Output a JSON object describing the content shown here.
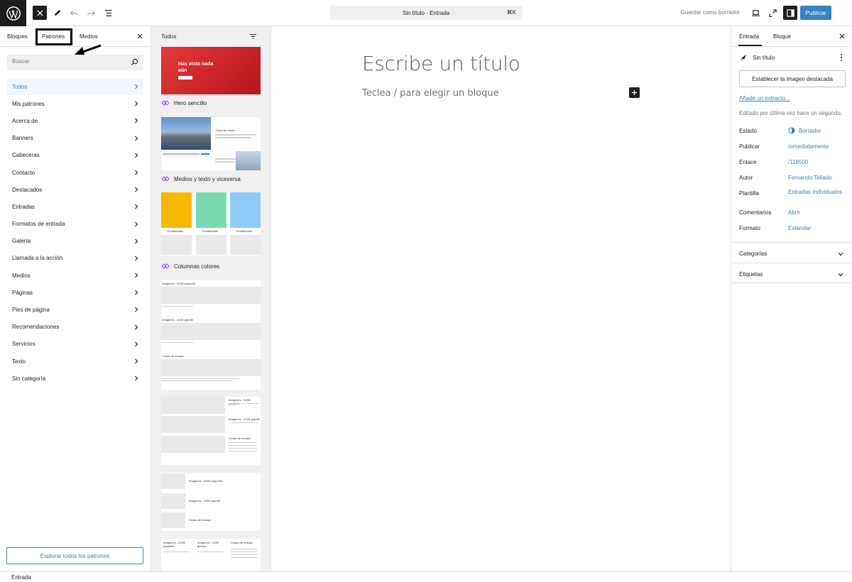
{
  "topbar": {
    "command_title": "Sin título · Entrada",
    "command_shortcut": "⌘K",
    "save_draft": "Guardar como borrador",
    "publish": "Publicar"
  },
  "inserter": {
    "tabs": [
      "Bloques",
      "Patrones",
      "Medios"
    ],
    "search_placeholder": "Buscar",
    "categories": [
      "Todos",
      "Mis patrones",
      "Acerca de",
      "Banners",
      "Cabeceras",
      "Contacto",
      "Destacados",
      "Entradas",
      "Formatos de entrada",
      "Galería",
      "Llamada a la acción",
      "Medios",
      "Páginas",
      "Pies de página",
      "Recomendaciones",
      "Servicios",
      "Texto",
      "Sin categoría"
    ],
    "explore_button": "Explorar todos los patrones"
  },
  "patterns": {
    "title": "Todos",
    "items": [
      {
        "label": "Hero sencillo",
        "preview_text": "Has visto nada aún",
        "preview_button": "Saber más"
      },
      {
        "label": "Medios y texto y viceversa",
        "preview_text": "Título del medio"
      },
      {
        "label": "Columnas colores",
        "col_label": "Encabezado"
      }
    ],
    "preview_texts": {
      "img_small": "Imágenes - DOM pequeño",
      "img_big": "Imágenes - DOM grande",
      "cosas": "Cosas de ensayo"
    }
  },
  "editor": {
    "title_placeholder": "Escribe un título",
    "block_placeholder": "Teclea / para elegir un bloque"
  },
  "settings": {
    "tabs": [
      "Entrada",
      "Bloque"
    ],
    "post_title": "Sin título",
    "featured_image": "Establecer la imagen destacada",
    "excerpt_link": "Añade un extracto...",
    "last_edited": "Editado por última vez hace un segundo.",
    "meta": [
      {
        "label": "Estado",
        "value": "Borrador"
      },
      {
        "label": "Publicar",
        "value": "Inmediatamente"
      },
      {
        "label": "Enlace",
        "value": "/118500"
      },
      {
        "label": "Autor",
        "value": "Fernando Tellado"
      },
      {
        "label": "Plantilla",
        "value": "Entradas individuales"
      },
      {
        "label": "Comentarios",
        "value": "Abrir"
      },
      {
        "label": "Formato",
        "value": "Estándar"
      }
    ],
    "sections": [
      "Categorías",
      "Etiquetas"
    ]
  },
  "footer": {
    "breadcrumb": "Entrada"
  },
  "colors": {
    "accent": "#3582c4",
    "dark": "#1e1e1e",
    "hero_red": "#d62828",
    "col_yellow": "#f6b900",
    "col_green": "#7ad9b0",
    "col_blue": "#8fcbf7"
  }
}
